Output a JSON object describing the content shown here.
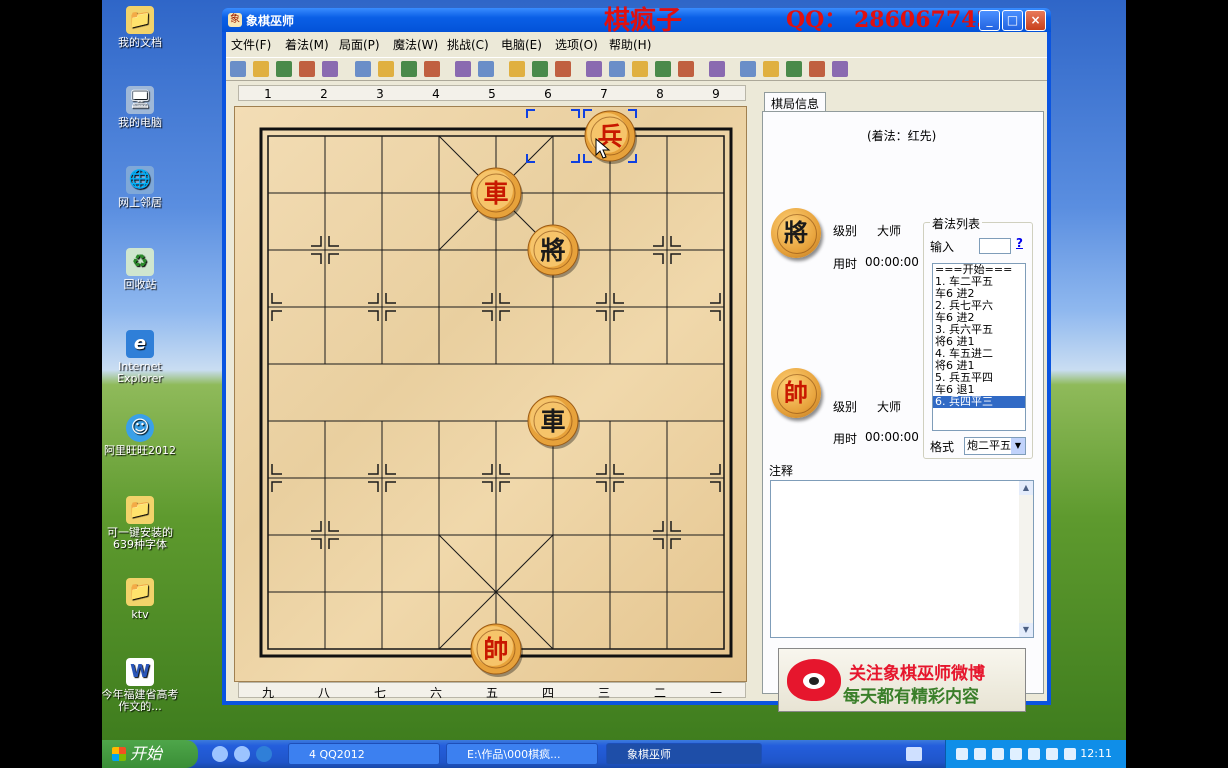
{
  "desktop": {
    "icons": [
      {
        "label": "我的文档",
        "icon": "folder-documents-icon"
      },
      {
        "label": "我的电脑",
        "icon": "computer-icon"
      },
      {
        "label": "网上邻居",
        "icon": "network-icon"
      },
      {
        "label": "回收站",
        "icon": "recycle-bin-icon"
      },
      {
        "label": "Internet Explorer",
        "icon": "ie-icon"
      },
      {
        "label": "阿里旺旺2012",
        "icon": "aliwangwang-icon"
      },
      {
        "label": "可一键安装的639种字体",
        "icon": "folder-icon"
      },
      {
        "label": "ktv",
        "icon": "folder-icon"
      },
      {
        "label": "今年福建省高考作文的...",
        "icon": "word-doc-icon"
      }
    ]
  },
  "watermark": {
    "name": "棋疯子",
    "qq": "QQ： 286067743",
    "color": "#e01010"
  },
  "window": {
    "title": "象棋巫师",
    "title_icon_char": "象",
    "controls": {
      "minimize": "_",
      "maximize": "□",
      "close": "×"
    },
    "menu": [
      "文件(F)",
      "着法(M)",
      "局面(P)",
      "魔法(W)",
      "挑战(C)",
      "电脑(E)",
      "选项(O)",
      "帮助(H)"
    ],
    "toolbar_icons": [
      "new-icon",
      "open-icon",
      "save-icon",
      "edit-icon",
      "properties-icon",
      "first-move-icon",
      "prev-move-icon",
      "next-move-icon",
      "last-move-icon",
      "delete-icon",
      "paste-icon",
      "book-icon",
      "tree-icon",
      "grid-icon",
      "color-icon",
      "engine-icon",
      "weibo-icon",
      "hint-icon",
      "clipboard-icon",
      "library-icon",
      "timer-icon",
      "print-icon",
      "print-preview-icon",
      "chart-icon",
      "stop-icon"
    ]
  },
  "board": {
    "top_coords": [
      "1",
      "2",
      "3",
      "4",
      "5",
      "6",
      "7",
      "8",
      "9"
    ],
    "bottom_coords": [
      "九",
      "八",
      "七",
      "六",
      "五",
      "四",
      "三",
      "二",
      "一"
    ],
    "pieces": [
      {
        "char": "兵",
        "color": "red",
        "file": 6,
        "rank": 0,
        "selected": true
      },
      {
        "char": "車",
        "color": "red",
        "file": 4,
        "rank": 1
      },
      {
        "char": "將",
        "color": "black",
        "file": 5,
        "rank": 2
      },
      {
        "char": "車",
        "color": "black",
        "file": 5,
        "rank": 5
      },
      {
        "char": "帥",
        "color": "red",
        "file": 4,
        "rank": 9
      }
    ],
    "last_move_from": {
      "file": 5,
      "rank": 0
    },
    "red_color": "#c81800",
    "black_color": "#1a1a1a"
  },
  "panel": {
    "tab_label": "棋局信息",
    "side_to_move": "(着法：红先)",
    "top_player": {
      "piece": "將",
      "level_label": "级别",
      "level": "大师",
      "time_label": "用时",
      "time": "00:00:00"
    },
    "bottom_player": {
      "piece": "帥",
      "level_label": "级别",
      "level": "大师",
      "time_label": "用时",
      "time": "00:00:00"
    },
    "movelist": {
      "title": "着法列表",
      "input_label": "输入",
      "help": "?",
      "moves": [
        "===开始===",
        "1. 车二平五",
        "   车6 进2",
        "2. 兵七平六",
        "   车6 进2",
        "3. 兵六平五",
        "   将6 进1",
        "4. 车五进二",
        "   将6 进1",
        "5. 兵五平四",
        "   车6 退1",
        "6. 兵四平三"
      ],
      "selected_index": 11,
      "format_label": "格式",
      "format_value": "炮二平五"
    },
    "notes_label": "注释",
    "banner": {
      "line1": "关注象棋巫师微博",
      "line2": "每天都有精彩内容"
    }
  },
  "taskbar": {
    "start": "开始",
    "buttons": [
      {
        "label": "4 QQ2012",
        "active": false
      },
      {
        "label": "E:\\作品\\000棋疯...",
        "active": false
      },
      {
        "label": "象棋巫师",
        "active": true
      }
    ],
    "clock": "12:11"
  }
}
